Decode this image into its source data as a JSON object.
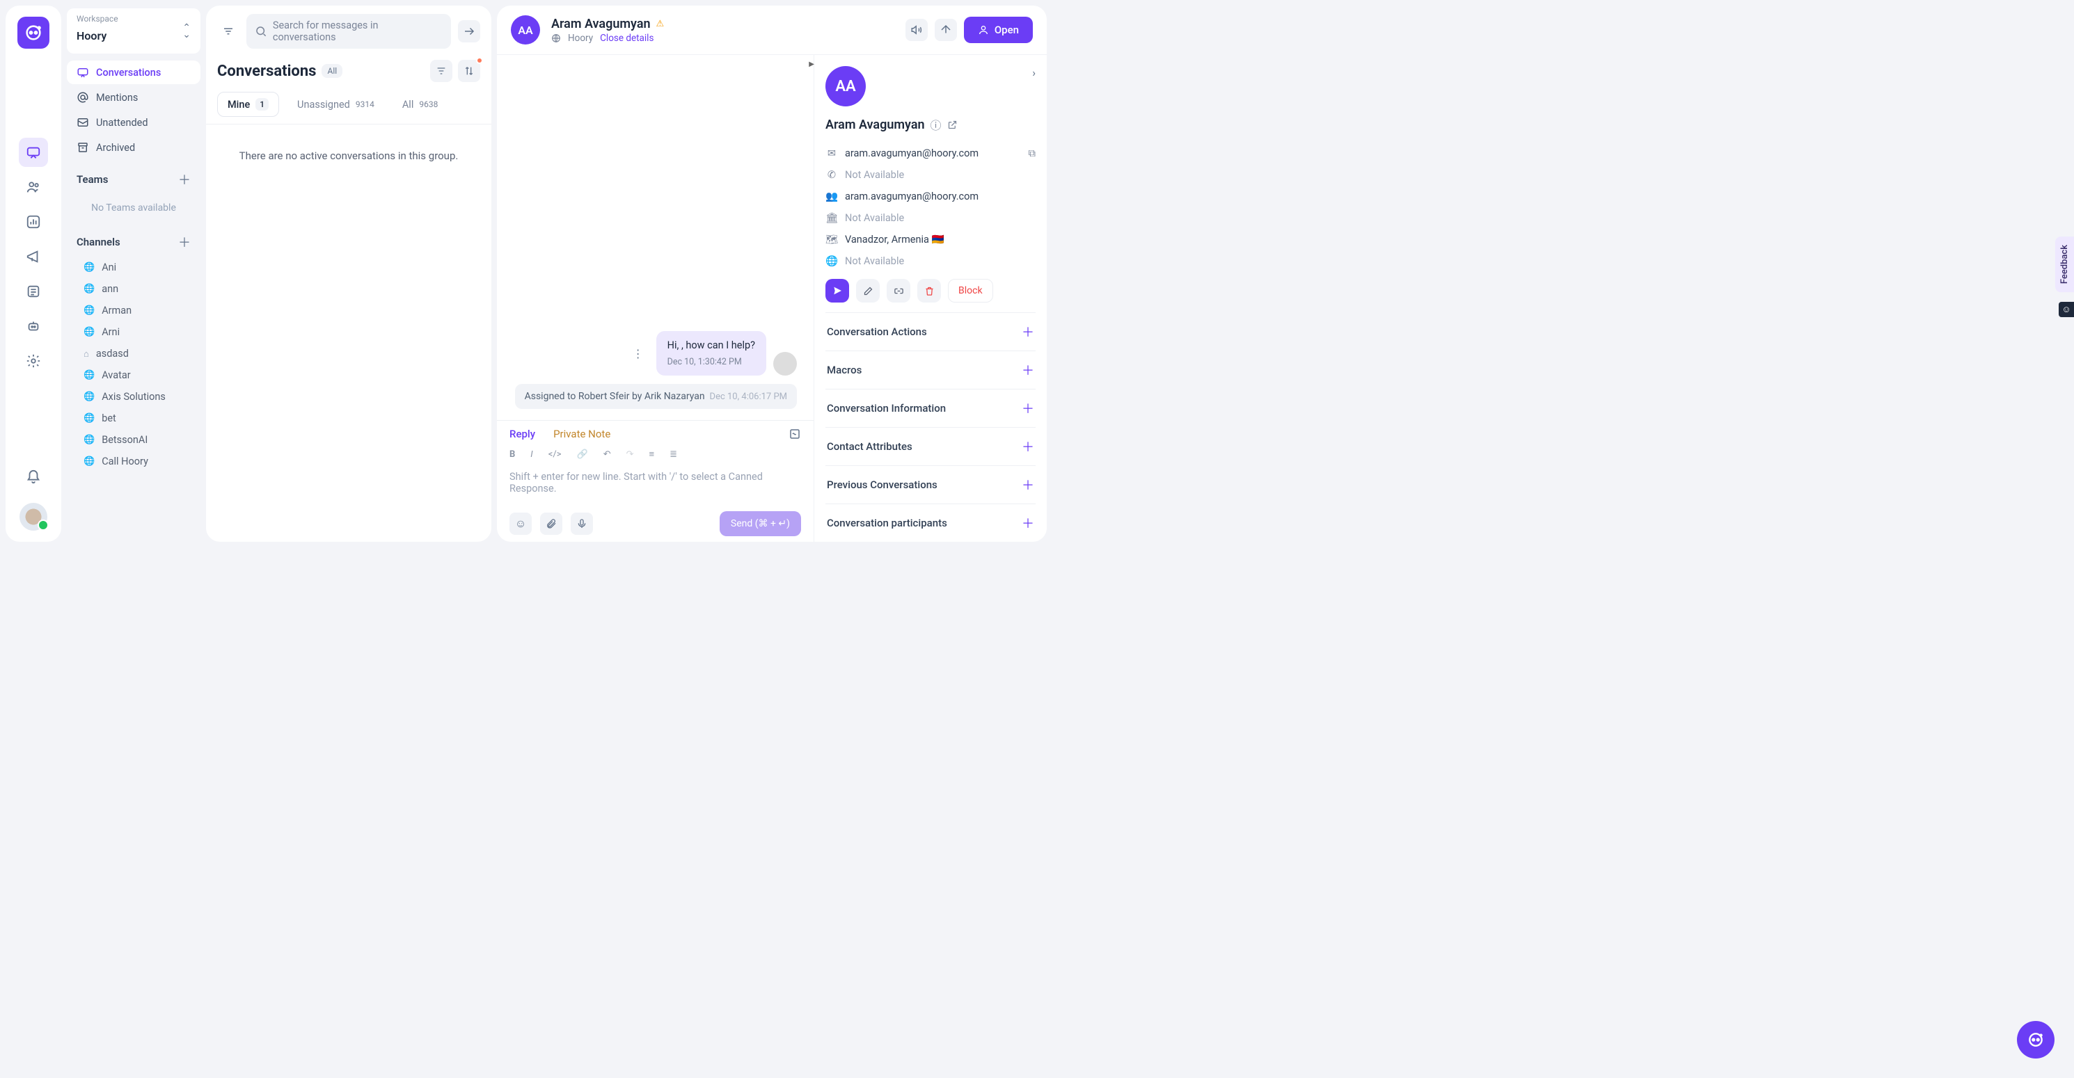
{
  "workspace": {
    "label": "Workspace",
    "name": "Hoory"
  },
  "nav": {
    "conversations": "Conversations",
    "mentions": "Mentions",
    "unattended": "Unattended",
    "archived": "Archived",
    "teams_header": "Teams",
    "teams_empty": "No Teams available",
    "channels_header": "Channels",
    "channels": [
      "Ani",
      "ann",
      "Arman",
      "Arni",
      "asdasd",
      "Avatar",
      "Axis Solutions",
      "bet",
      "BetssonAI",
      "Call Hoory"
    ]
  },
  "list": {
    "search_placeholder": "Search for messages in conversations",
    "title": "Conversations",
    "all_pill": "All",
    "tab_mine": "Mine",
    "mine_count": "1",
    "tab_unassigned": "Unassigned",
    "unassigned_count": "9314",
    "tab_all": "All",
    "all_count": "9638",
    "empty": "There are no active conversations in this group."
  },
  "conversation": {
    "avatar_text": "AA",
    "name": "Aram Avagumyan",
    "channel": "Hoory",
    "close_details": "Close details",
    "open_btn": "Open",
    "message_text": "Hi, , how can I help?",
    "message_ts": "Dec 10, 1:30:42 PM",
    "system_text": "Assigned to Robert Sfeir by Arik Nazaryan",
    "system_ts": "Dec 10, 4:06:17 PM",
    "reply_tab": "Reply",
    "note_tab": "Private Note",
    "composer_placeholder": "Shift + enter for new line. Start with '/' to select a Canned Response.",
    "send_btn": "Send (⌘ + ↵)"
  },
  "details": {
    "avatar_text": "AA",
    "name": "Aram Avagumyan",
    "email": "aram.avagumyan@hoory.com",
    "phone_na": "Not Available",
    "email2": "aram.avagumyan@hoory.com",
    "org_na": "Not Available",
    "location": "Vanadzor, Armenia 🇦🇲",
    "social_na": "Not Available",
    "block": "Block",
    "sections": [
      "Conversation Actions",
      "Macros",
      "Conversation Information",
      "Contact Attributes",
      "Previous Conversations",
      "Conversation participants"
    ]
  },
  "feedback_label": "Feedback"
}
